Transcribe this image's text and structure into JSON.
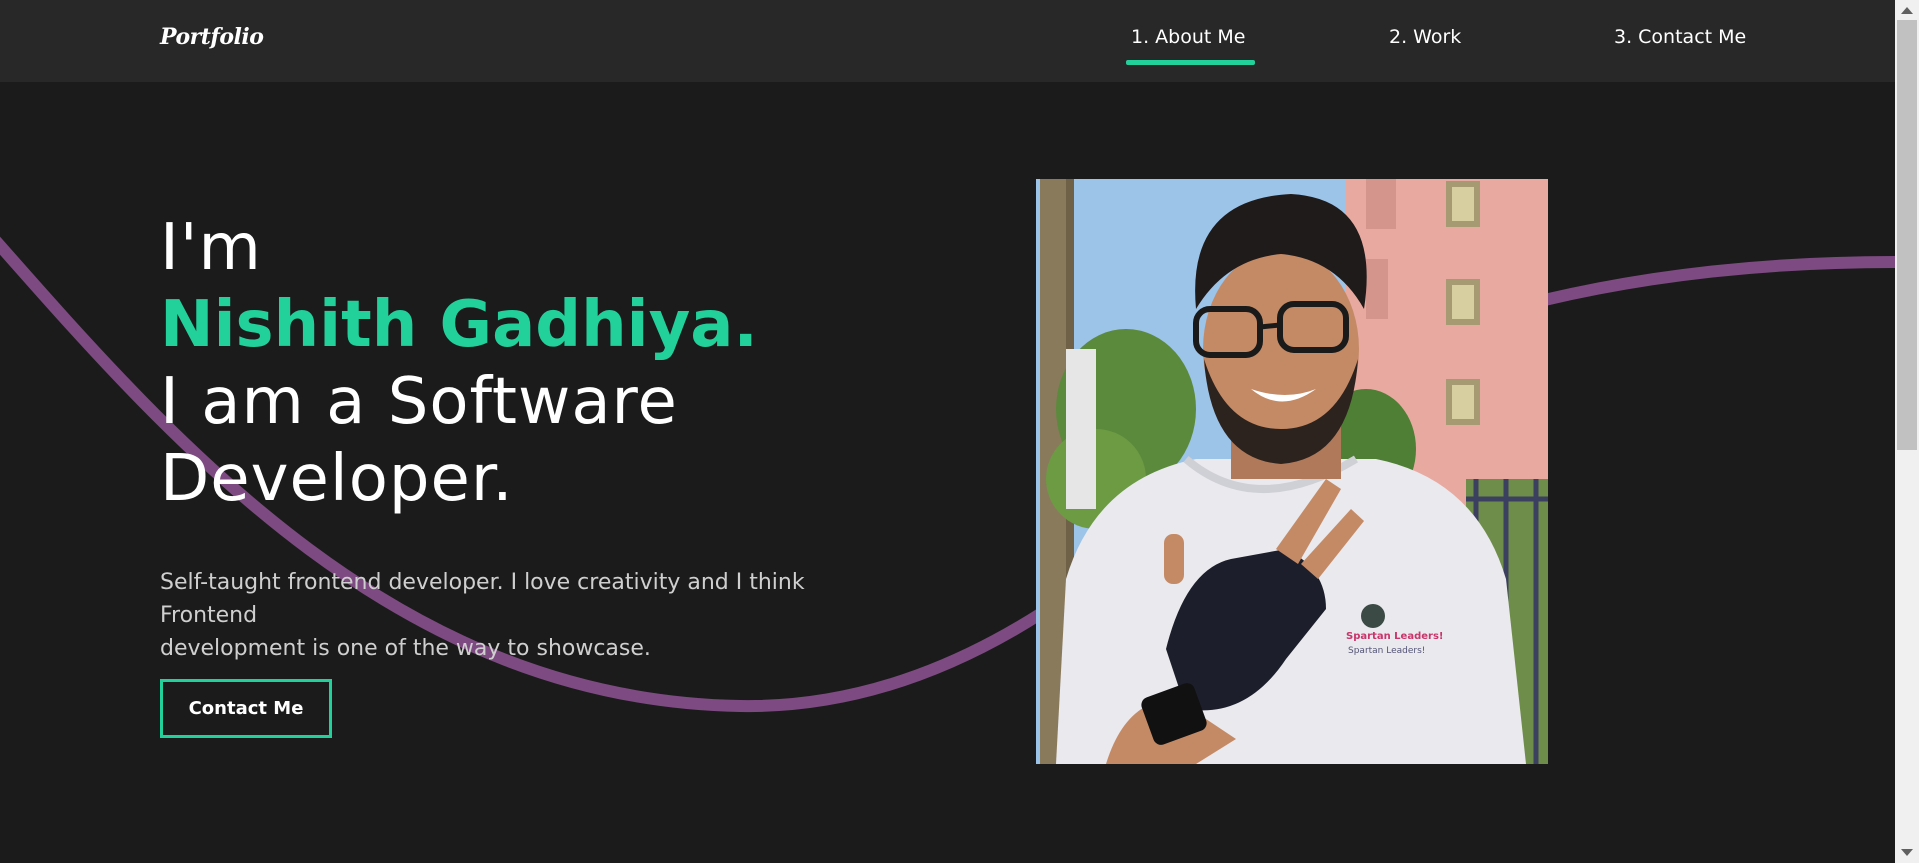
{
  "navbar": {
    "logo": "Portfolio",
    "items": [
      {
        "label": "1. About Me",
        "active": true
      },
      {
        "label": "2. Work",
        "active": false
      },
      {
        "label": "3. Contact Me",
        "active": false
      }
    ]
  },
  "hero": {
    "line1": "I'm",
    "name": "Nishith Gadhiya.",
    "line3": "I am a Software",
    "line4": "Developer.",
    "description_line1": "Self-taught frontend developer. I love creativity and I think Frontend",
    "description_line2": "development is one of the way to showcase.",
    "cta_label": "Contact Me"
  },
  "colors": {
    "accent": "#22d09a",
    "curve": "#7d4a82",
    "background": "#1b1b1b",
    "navbar": "#282828"
  },
  "profile_photo": {
    "shirt_text_1": "Spartan Leaders!",
    "shirt_text_2": "Spartan Leaders!"
  }
}
